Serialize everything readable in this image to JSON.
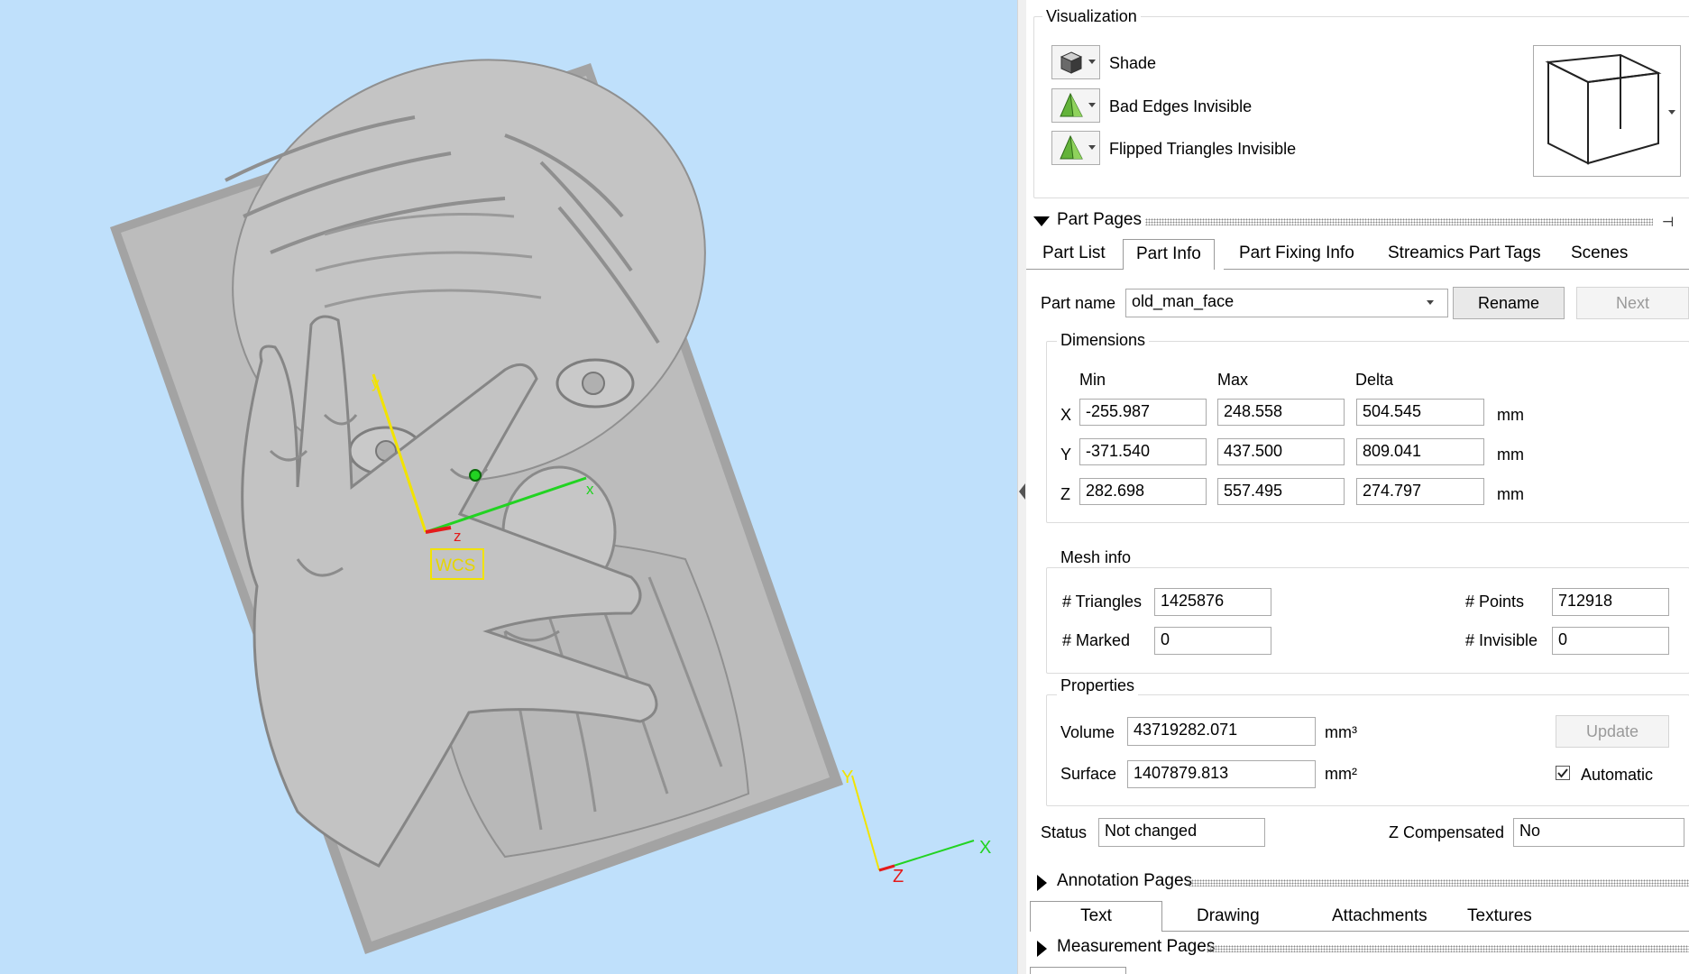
{
  "viewport": {
    "wcs_label": "WCS",
    "axis_local": {
      "x": "x",
      "y": "y",
      "z": "z"
    },
    "axis_global": {
      "x": "X",
      "y": "Y",
      "z": "Z"
    },
    "background": "#bfe0fb",
    "model_color": "#b9b9b9"
  },
  "visualization": {
    "title": "Visualization",
    "modes": [
      {
        "label": "Shade",
        "icon": "shaded-cube-icon"
      },
      {
        "label": "Bad Edges Invisible",
        "icon": "green-triangle-icon"
      },
      {
        "label": "Flipped Triangles Invisible",
        "icon": "green-triangle-icon"
      }
    ],
    "view_icon": "wireframe-cube-icon"
  },
  "part_pages": {
    "title": "Part Pages",
    "tabs": [
      "Part List",
      "Part Info",
      "Part Fixing Info",
      "Streamics Part Tags",
      "Scenes"
    ],
    "active_tab": "Part Info",
    "part_name_label": "Part name",
    "part_name_value": "old_man_face",
    "rename_label": "Rename",
    "next_label": "Next",
    "dimensions": {
      "title": "Dimensions",
      "headers": [
        "Min",
        "Max",
        "Delta"
      ],
      "rows": [
        {
          "axis": "X",
          "min": "-255.987",
          "max": "248.558",
          "delta": "504.545",
          "unit": "mm"
        },
        {
          "axis": "Y",
          "min": "-371.540",
          "max": "437.500",
          "delta": "809.041",
          "unit": "mm"
        },
        {
          "axis": "Z",
          "min": "282.698",
          "max": "557.495",
          "delta": "274.797",
          "unit": "mm"
        }
      ]
    },
    "mesh_info": {
      "title": "Mesh info",
      "triangles_label": "# Triangles",
      "triangles": "1425876",
      "points_label": "# Points",
      "points": "712918",
      "marked_label": "# Marked",
      "marked": "0",
      "invisible_label": "# Invisible",
      "invisible": "0"
    },
    "properties": {
      "title": "Properties",
      "volume_label": "Volume",
      "volume": "43719282.071",
      "volume_unit": "mm³",
      "surface_label": "Surface",
      "surface": "1407879.813",
      "surface_unit": "mm²",
      "update_label": "Update",
      "automatic_label": "Automatic",
      "automatic_checked": true
    },
    "status_label": "Status",
    "status": "Not changed",
    "zcomp_label": "Z Compensated",
    "zcomp": "No"
  },
  "annotation_pages": {
    "title": "Annotation Pages",
    "tabs": [
      "Text",
      "Drawing",
      "Attachments",
      "Textures"
    ],
    "active_tab": "Text"
  },
  "measurement_pages": {
    "title": "Measurement Pages"
  }
}
